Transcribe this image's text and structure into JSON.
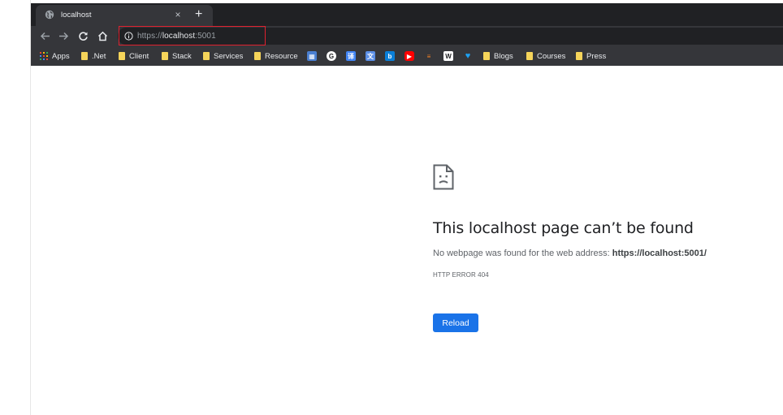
{
  "tab": {
    "title": "localhost",
    "close": "×",
    "new_tab": "+"
  },
  "omnibox": {
    "url_scheme": "https://",
    "url_host": "localhost",
    "url_port": ":5001"
  },
  "bookmarks": [
    {
      "type": "apps",
      "label": "Apps"
    },
    {
      "type": "folder",
      "label": ".Net"
    },
    {
      "type": "folder",
      "label": "Client"
    },
    {
      "type": "folder",
      "label": "Stack"
    },
    {
      "type": "folder",
      "label": "Services"
    },
    {
      "type": "folder",
      "label": "Resource"
    },
    {
      "type": "icon",
      "icon": "news-icon"
    },
    {
      "type": "icon",
      "icon": "google-icon"
    },
    {
      "type": "icon",
      "icon": "translate-icon"
    },
    {
      "type": "icon",
      "icon": "translator-icon"
    },
    {
      "type": "icon",
      "icon": "bing-icon"
    },
    {
      "type": "icon",
      "icon": "youtube-icon"
    },
    {
      "type": "icon",
      "icon": "stackoverflow-icon"
    },
    {
      "type": "icon",
      "icon": "wordpress-icon"
    },
    {
      "type": "icon",
      "icon": "twitter-icon"
    },
    {
      "type": "folder",
      "label": "Blogs"
    },
    {
      "type": "folder",
      "label": "Courses"
    },
    {
      "type": "folder",
      "label": "Press"
    }
  ],
  "error": {
    "title": "This localhost page can’t be found",
    "desc_prefix": "No webpage was found for the web address: ",
    "desc_url": "https://localhost:5001/",
    "code": "HTTP ERROR 404",
    "reload_label": "Reload"
  },
  "colors": {
    "tabstrip": "#202124",
    "toolbar": "#35363a",
    "highlight": "#e0212f",
    "reload_button": "#1a73e8",
    "folder": "#f5d45a"
  }
}
